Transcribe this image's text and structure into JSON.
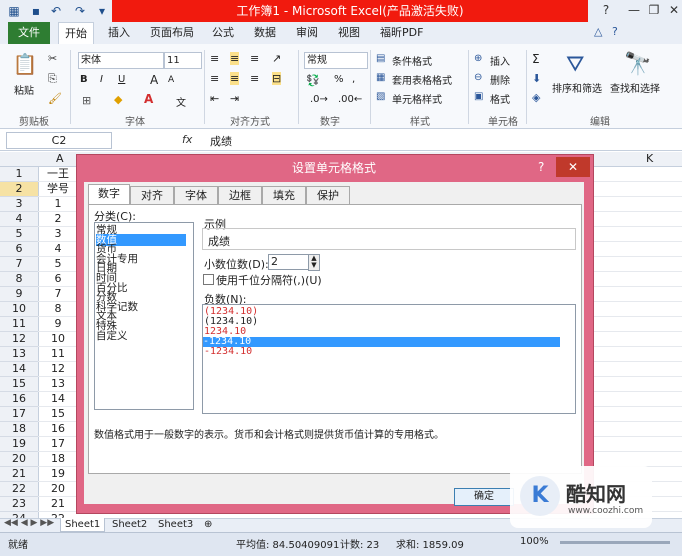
{
  "window": {
    "title": "工作簿1 - Microsoft Excel(产品激活失败)",
    "help": "?",
    "minimize": "—",
    "restore": "❐",
    "close": "✕"
  },
  "tabs": [
    "文件",
    "开始",
    "插入",
    "页面布局",
    "公式",
    "数据",
    "审阅",
    "视图",
    "福昕PDF"
  ],
  "ribbon": {
    "clipboard": {
      "paste": "粘贴",
      "group": "剪贴板"
    },
    "font": {
      "name": "宋体",
      "size": "11",
      "bold": "B",
      "italic": "I",
      "underline": "U",
      "grow": "A",
      "shrink": "A",
      "wen": "文",
      "group": "字体"
    },
    "alignment": {
      "group": "对齐方式"
    },
    "number": {
      "format": "常规",
      "currency": "%",
      "comma": ",",
      "group": "数字"
    },
    "styles": {
      "conditional": "条件格式",
      "table": "套用表格格式",
      "cell": "单元格样式",
      "group": "样式"
    },
    "cells": {
      "insert": "插入",
      "delete": "删除",
      "format": "格式",
      "group": "单元格"
    },
    "editing": {
      "sort": "排序和筛选",
      "find": "查找和选择",
      "group": "编辑"
    }
  },
  "formula_bar": {
    "name_box": "C2",
    "fx": "fx",
    "value": "成绩"
  },
  "grid": {
    "col_a": "A",
    "col_k": "K",
    "a1": "一王",
    "a2": "学号",
    "rows": [
      "1",
      "2",
      "3",
      "4",
      "5",
      "6",
      "7",
      "8",
      "9",
      "10",
      "11",
      "12",
      "13",
      "14",
      "15",
      "16",
      "17",
      "18",
      "19",
      "20",
      "21",
      "22",
      "23",
      "24"
    ],
    "a_values": [
      "1",
      "2",
      "3",
      "4",
      "5",
      "6",
      "7",
      "8",
      "9",
      "10",
      "11",
      "12",
      "13",
      "14",
      "15",
      "16",
      "17",
      "18",
      "19",
      "20",
      "21",
      "22"
    ]
  },
  "sheets": [
    "Sheet1",
    "Sheet2",
    "Sheet3"
  ],
  "status": {
    "mode": "就绪",
    "average": "平均值: 84.50409091",
    "count": "计数: 23",
    "sum": "求和: 1859.09",
    "zoom": "100%"
  },
  "dialog": {
    "title": "设置单元格格式",
    "help": "?",
    "close": "✕",
    "tabs": [
      "数字",
      "对齐",
      "字体",
      "边框",
      "填充",
      "保护"
    ],
    "category_label": "分类(C):",
    "categories": [
      "常规",
      "数值",
      "货币",
      "会计专用",
      "日期",
      "时间",
      "百分比",
      "分数",
      "科学记数",
      "文本",
      "特殊",
      "自定义"
    ],
    "selected_category": "数值",
    "sample_label": "示例",
    "sample_value": "成绩",
    "decimals_label": "小数位数(D):",
    "decimals_value": "2",
    "thousands_label": "使用千位分隔符(,)(U)",
    "negative_label": "负数(N):",
    "negatives": [
      "(1234.10)",
      "(1234.10)",
      "1234.10",
      "-1234.10",
      "-1234.10"
    ],
    "description": "数值格式用于一般数字的表示。货币和会计格式则提供货币值计算的专用格式。",
    "ok": "确定"
  },
  "watermark": {
    "brand": "酷知网",
    "url": "www.coozhi.com"
  },
  "colors": {
    "title_red": "#f11a0e",
    "dialog_frame": "#e06785",
    "file_tab": "#2e7d32",
    "selection": "#3399ff",
    "negative_red": "#d32f2f"
  }
}
